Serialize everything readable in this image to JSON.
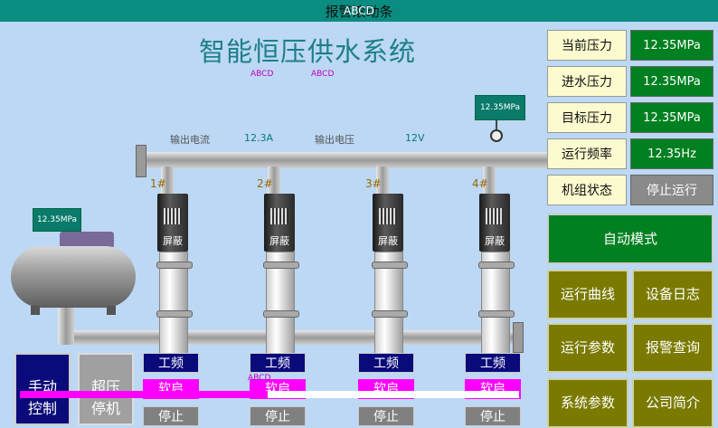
{
  "topbar": {
    "title": "报警滚动条",
    "overlay": "ABCD"
  },
  "main": {
    "title": "智能恒压供水系统",
    "tag1": "ABCD",
    "tag2": "ABCD",
    "current_label": "输出电流",
    "current_value": "12.3A",
    "voltage_label": "输出电压",
    "voltage_value": "12V",
    "outlet_gauge": "12.35MPa",
    "tank_gauge": "12.35MPa",
    "scroll_text": "ABCD"
  },
  "pumps": [
    {
      "num": "1#",
      "motor_label": "屏蔽",
      "mode": "工频",
      "soft": "软启",
      "stop": "停止"
    },
    {
      "num": "2#",
      "motor_label": "屏蔽",
      "mode": "工频",
      "soft": "软启",
      "stop": "停止"
    },
    {
      "num": "3#",
      "motor_label": "屏蔽",
      "mode": "工频",
      "soft": "软启",
      "stop": "停止"
    },
    {
      "num": "4#",
      "motor_label": "屏蔽",
      "mode": "工频",
      "soft": "软启",
      "stop": "停止"
    }
  ],
  "left_buttons": {
    "manual": "手动\n控制",
    "boost": "超压\n停机"
  },
  "status_panel": [
    {
      "label": "当前压力",
      "value": "12.35MPa"
    },
    {
      "label": "进水压力",
      "value": "12.35MPa"
    },
    {
      "label": "目标压力",
      "value": "12.35MPa"
    },
    {
      "label": "运行频率",
      "value": "12.35Hz"
    },
    {
      "label": "机组状态",
      "value": "停止运行"
    }
  ],
  "auto_mode": "自动模式",
  "nav_buttons": [
    "运行曲线",
    "设备日志",
    "运行参数",
    "报警查询",
    "系统参数",
    "公司简介"
  ],
  "colors": {
    "accent": "#0a8c80",
    "running_green": "#008020",
    "olive": "#7a7a00",
    "navy": "#0a0a7a",
    "magenta": "#ff00ff"
  }
}
